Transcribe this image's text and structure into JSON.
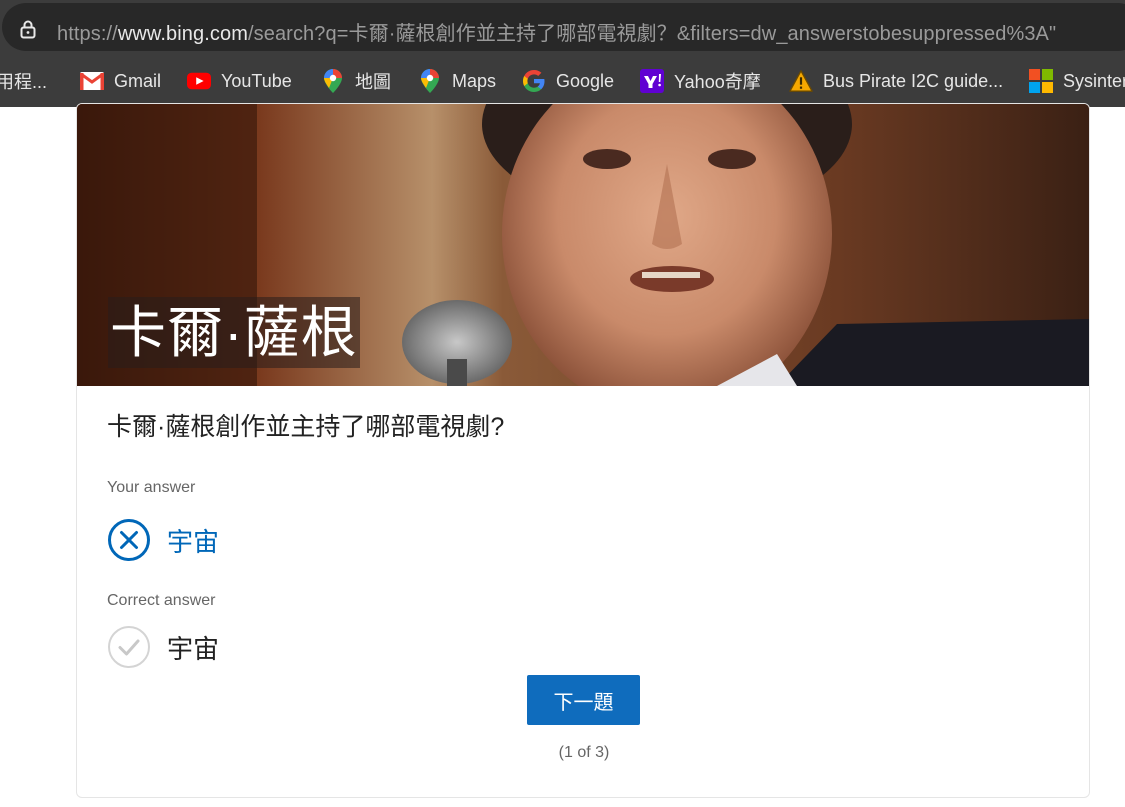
{
  "browser": {
    "url_prefix": "https://",
    "url_host": "www.bing.com",
    "url_rest": "/search?q=卡爾·薩根創作並主持了哪部電視劇？&filters=dw_answerstobesuppressed%3A\"",
    "bookmarks": [
      {
        "label": "用程...",
        "icon": "app-icon"
      },
      {
        "label": "Gmail",
        "icon": "gmail-icon"
      },
      {
        "label": "YouTube",
        "icon": "youtube-icon"
      },
      {
        "label": "地圖",
        "icon": "maps-pin-icon"
      },
      {
        "label": "Maps",
        "icon": "maps-pin-icon"
      },
      {
        "label": "Google",
        "icon": "google-icon"
      },
      {
        "label": "Yahoo奇摩",
        "icon": "yahoo-icon"
      },
      {
        "label": "Bus Pirate I2C guide...",
        "icon": "warning-icon"
      },
      {
        "label": "Sysinter",
        "icon": "microsoft-icon"
      }
    ]
  },
  "quiz": {
    "hero_title": "卡爾·薩根",
    "question": "卡爾·薩根創作並主持了哪部電視劇?",
    "your_answer_label": "Your answer",
    "your_answer": "宇宙",
    "correct_answer_label": "Correct answer",
    "correct_answer": "宇宙",
    "next_button": "下一題",
    "progress": "(1 of 3)"
  },
  "colors": {
    "accent": "#0f6cbd",
    "wrong_answer": "#0067b8",
    "chrome_bg": "#3c3c3c"
  }
}
